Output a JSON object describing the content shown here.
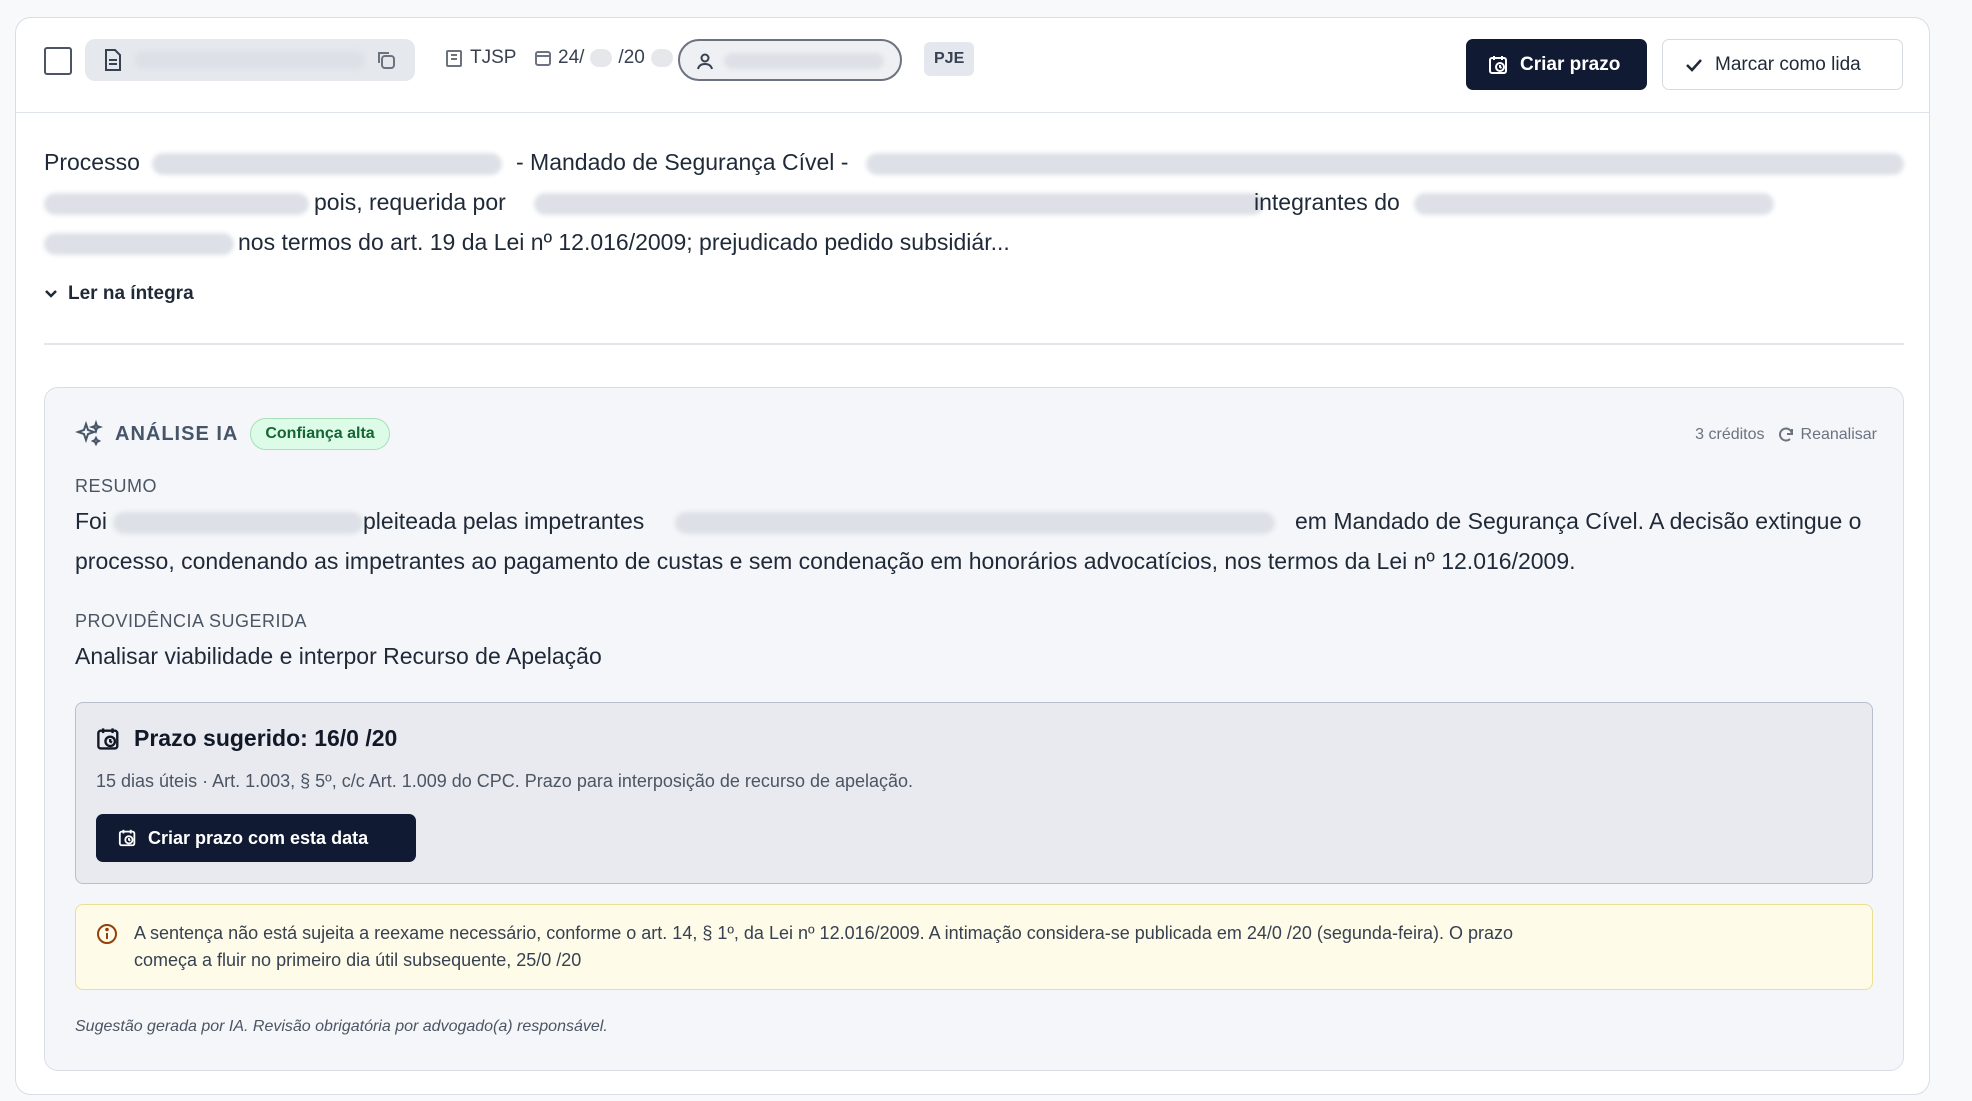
{
  "header": {
    "court": "TJSP",
    "date_prefix": "24/",
    "date_suffix": "/20",
    "system_badge": "PJE",
    "create_deadline_button": "Criar prazo",
    "mark_read_button": "Marcar como lida"
  },
  "publication": {
    "line1_prefix": "Processo",
    "line1_middle": "- Mandado de Segurança Cível -",
    "line2_a": "pois, requerida por",
    "line2_b": "integrantes do",
    "line3": "nos termos do art. 19 da Lei nº 12.016/2009; prejudicado pedido subsidiár...",
    "read_full_link": "Ler na íntegra"
  },
  "ai_analysis": {
    "title": "ANÁLISE IA",
    "confidence_badge": "Confiança alta",
    "credits": "3 créditos",
    "reanalyze_link": "Reanalisar",
    "summary_label": "RESUMO",
    "summary_line1_a": "Foi",
    "summary_line1_b": "pleiteada pelas impetrantes",
    "summary_line1_c": "em Mandado de Segurança Cível. A decisão extingue o",
    "summary_line2": "processo, condenando as impetrantes ao pagamento de custas e sem condenação em honorários advocatícios, nos termos da Lei nº 12.016/2009.",
    "action_label": "PROVIDÊNCIA SUGERIDA",
    "action_text": "Analisar viabilidade e interpor Recurso de Apelação",
    "deadline_title": "Prazo sugerido: 16/0 /20",
    "deadline_detail": "15 dias úteis · Art. 1.003, § 5º, c/c Art. 1.009 do CPC. Prazo para interposição de recurso de apelação.",
    "deadline_button": "Criar prazo com esta data",
    "alert_line1": "A sentença não está sujeita a reexame necessário, conforme o art. 14, § 1º, da Lei nº 12.016/2009. A intimação considera-se publicada em 24/0 /20   (segunda-feira). O prazo",
    "alert_line2": "começa a fluir no primeiro dia útil subsequente, 25/0 /20",
    "footnote": "Sugestão gerada por IA. Revisão obrigatória por advogado(a) responsável."
  },
  "colors": {
    "primary_dark": "#111a33",
    "badge_green": "#dcfce7",
    "alert_yellow": "#fefbe8"
  }
}
